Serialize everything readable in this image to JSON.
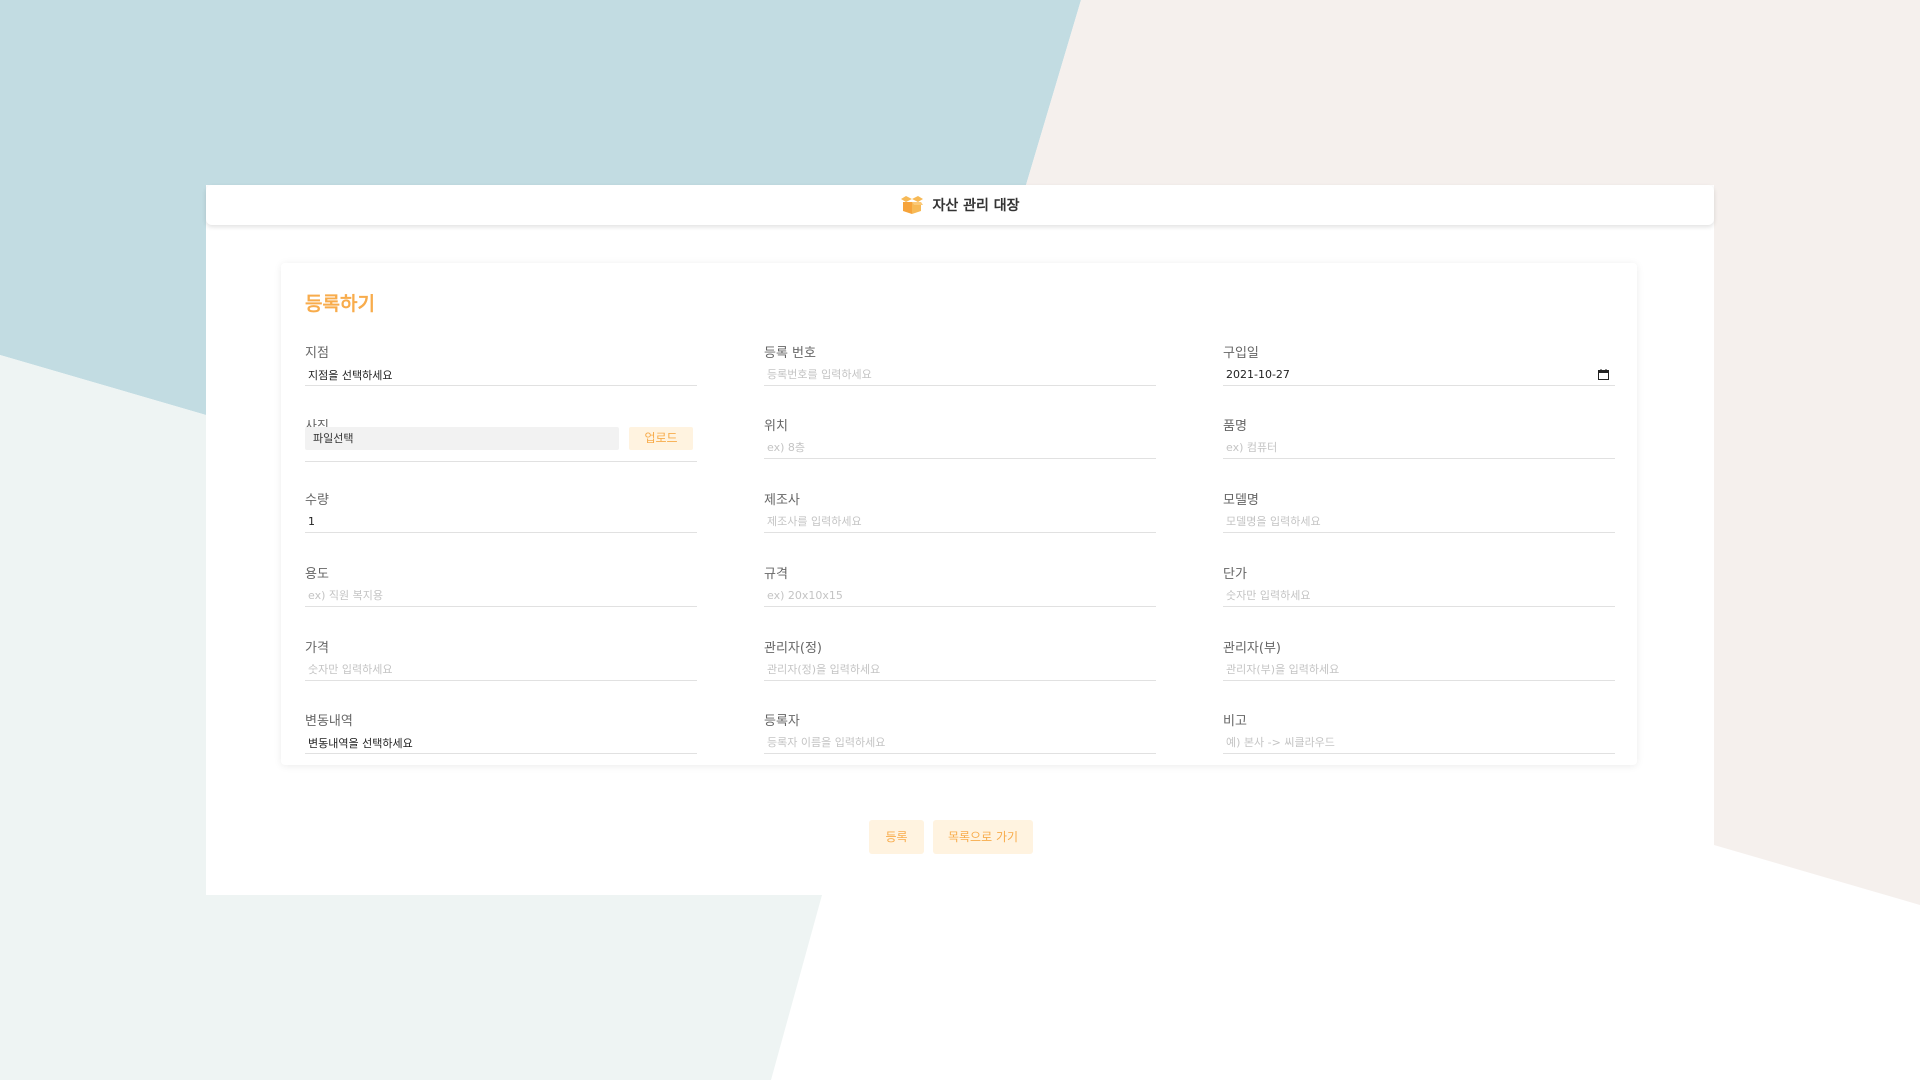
{
  "colors": {
    "bg_blue": "#c2dce2",
    "bg_beige": "#f5f0ed",
    "bg_mint": "#eef4f3",
    "accent": "#f8ac4c",
    "button_bg": "#fff3e0"
  },
  "header": {
    "icon": "box-icon",
    "title": "자산 관리 대장"
  },
  "form": {
    "title": "등록하기",
    "fields": {
      "branch": {
        "label": "지점",
        "value": "지점을 선택하세요"
      },
      "reg_no": {
        "label": "등록 번호",
        "placeholder": "등록번호를 입력하세요"
      },
      "purchase_date": {
        "label": "구입일",
        "value": "2021-10-27",
        "icon": "calendar-icon"
      },
      "photo": {
        "label": "사진",
        "file_text": "파일선택",
        "upload_label": "업로드"
      },
      "location": {
        "label": "위치",
        "placeholder": "ex) 8층"
      },
      "item_name": {
        "label": "품명",
        "placeholder": "ex) 컴퓨터"
      },
      "quantity": {
        "label": "수량",
        "value": "1"
      },
      "manufacturer": {
        "label": "제조사",
        "placeholder": "제조사를 입력하세요"
      },
      "model": {
        "label": "모델명",
        "placeholder": "모델명을 입력하세요"
      },
      "usage": {
        "label": "용도",
        "placeholder": "ex) 직원 복지용"
      },
      "spec": {
        "label": "규격",
        "placeholder": "ex) 20x10x15"
      },
      "unit_price": {
        "label": "단가",
        "placeholder": "숫자만 입력하세요"
      },
      "price": {
        "label": "가격",
        "placeholder": "숫자만 입력하세요"
      },
      "manager_main": {
        "label": "관리자(정)",
        "placeholder": "관리자(정)을 입력하세요"
      },
      "manager_sub": {
        "label": "관리자(부)",
        "placeholder": "관리자(부)을 입력하세요"
      },
      "change_history": {
        "label": "변동내역",
        "value": "변동내역을 선택하세요"
      },
      "registrant": {
        "label": "등록자",
        "placeholder": "등록자 이름을 입력하세요"
      },
      "note": {
        "label": "비고",
        "placeholder": "예) 본사 -> 씨클라우드"
      }
    }
  },
  "actions": {
    "submit_label": "등록",
    "back_label": "목록으로 가기"
  }
}
